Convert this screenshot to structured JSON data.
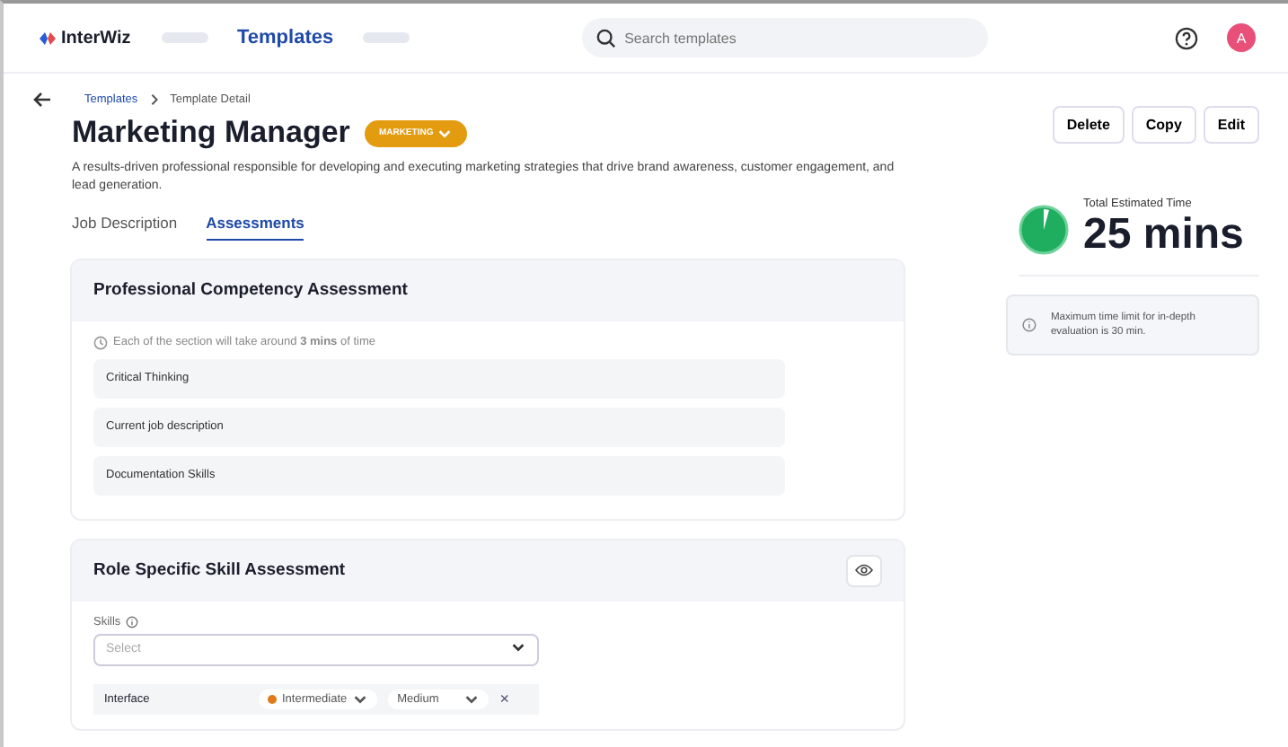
{
  "header": {
    "logo": "InterWiz",
    "nav": [
      {
        "label": "Templates",
        "selected": true
      }
    ],
    "search": {
      "placeholder": "Search templates"
    },
    "avatar": "A"
  },
  "breadcrumb": [
    "Templates",
    "Template Detail"
  ],
  "title": "Marketing Manager",
  "tag": "MARKETING",
  "description": "A results-driven professional responsible for developing and executing marketing strategies that drive brand awareness, customer engagement, and lead generation.",
  "actions": [
    "Delete",
    "Copy",
    "Edit"
  ],
  "tabs": [
    {
      "label": "Job Description",
      "selected": false
    },
    {
      "label": "Assessments",
      "selected": true
    }
  ],
  "competency": {
    "title": "Professional Competency Assessment",
    "note": "Each of the section will take around **3 mins** of time",
    "items": [
      "Critical Thinking",
      "Current job description",
      "Documentation Skills"
    ]
  },
  "role_skill": {
    "title": "Role Specific Skill Assessment",
    "skills_label": "Skills",
    "select": {
      "placeholder": "Select"
    },
    "rows": [
      {
        "name": "Interface",
        "level": "Intermediate",
        "color": "#e07b1a",
        "difficulty": "Medium",
        "remove": "×"
      }
    ]
  },
  "estimate": {
    "label": "Total Estimated Time",
    "value": "25 mins",
    "info": "Maximum time limit for in-depth evaluation is 30 min."
  }
}
